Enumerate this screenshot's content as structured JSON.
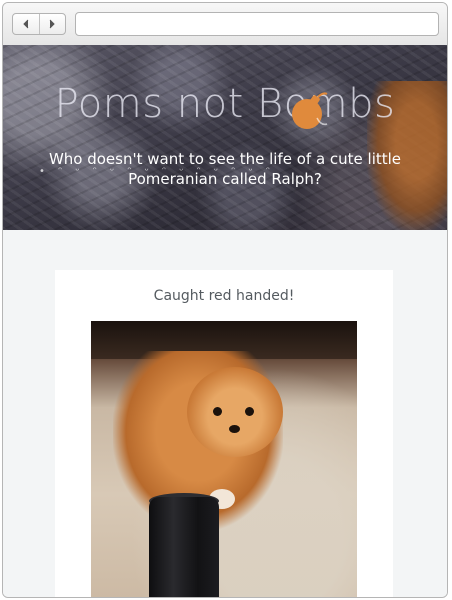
{
  "browser": {
    "back_icon": "chevron-left-icon",
    "forward_icon": "chevron-right-icon",
    "address_value": ""
  },
  "hero": {
    "title": "Poms not Bombs",
    "tagline": "Who doesn't want to see the life of a cute little Pomeranian called Ralph?",
    "decor_icon": "paw-prints-icon"
  },
  "post": {
    "title": "Caught red handed!",
    "image_icon": "dog-photo"
  },
  "colors": {
    "page_bg": "#f3f5f6",
    "card_bg": "#ffffff",
    "bomb": "#e08a3c"
  }
}
